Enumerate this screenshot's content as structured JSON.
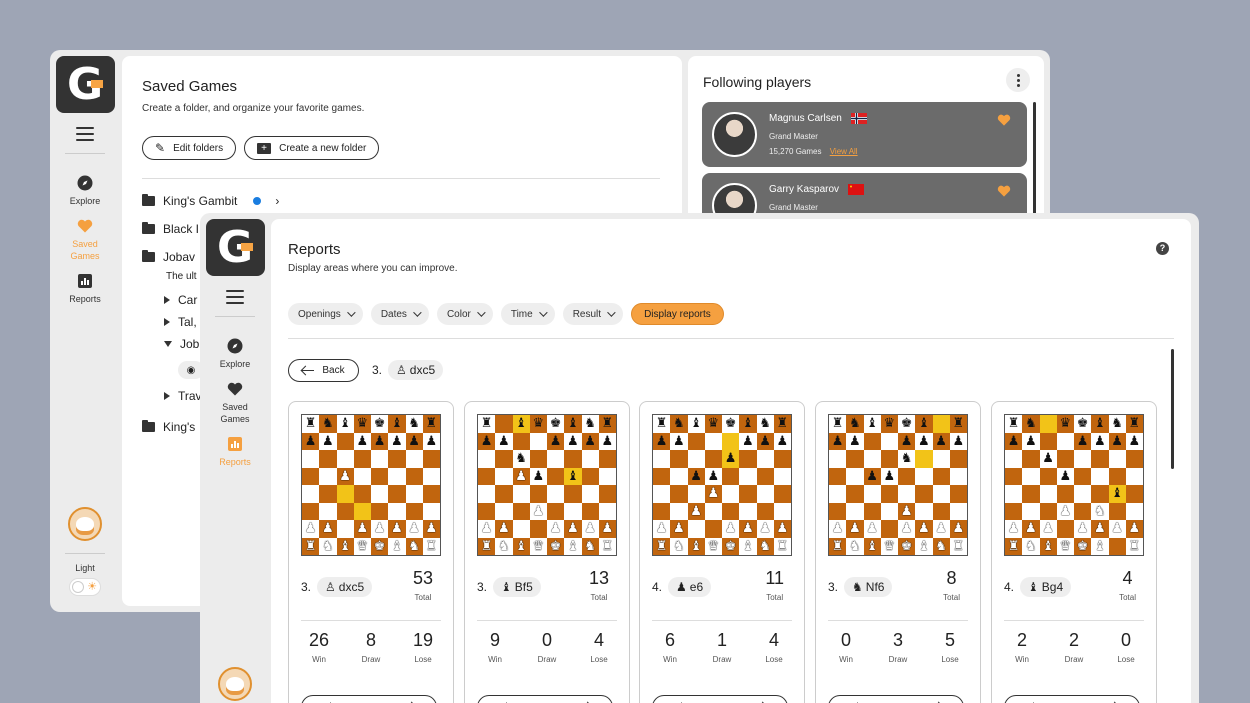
{
  "back": {
    "nav": [
      {
        "label": "Explore",
        "icon": "compass-icon"
      },
      {
        "label": "Saved Games",
        "icon": "heart-icon"
      },
      {
        "label": "Reports",
        "icon": "bar-chart-icon"
      }
    ],
    "theme_label": "Light",
    "saved": {
      "title": "Saved Games",
      "subtitle": "Create a folder, and organize your favorite games.",
      "edit_folders": "Edit folders",
      "create_folder": "Create a new folder",
      "folders": [
        "King's Gambit",
        "Black I",
        "Jobav",
        "King's"
      ],
      "jobav_desc": "The ult",
      "subfolders": [
        "Car",
        "Tal,",
        "Job",
        "Trav"
      ]
    },
    "following": {
      "title": "Following players",
      "players": [
        {
          "name": "Magnus Carlsen",
          "rank": "Grand Master",
          "games": "15,270 Games",
          "view_all": "View All"
        },
        {
          "name": "Garry Kasparov",
          "rank": "Grand Master"
        }
      ]
    }
  },
  "front": {
    "nav": [
      {
        "label": "Explore"
      },
      {
        "label": "Saved Games"
      },
      {
        "label": "Reports"
      }
    ],
    "reports": {
      "title": "Reports",
      "subtitle": "Display areas where you can improve.",
      "help": "?",
      "filters": [
        "Openings",
        "Dates",
        "Color",
        "Time",
        "Result"
      ],
      "display_button": "Display reports",
      "back_button": "Back",
      "current_move": {
        "num": "3.",
        "san": "dxc5"
      },
      "total_label": "Total",
      "win_label": "Win",
      "draw_label": "Draw",
      "lose_label": "Lose",
      "view_games": "View games",
      "cards": [
        {
          "num": "3.",
          "san": "dxc5",
          "total": "53",
          "win": "26",
          "draw": "8",
          "lose": "19"
        },
        {
          "num": "3.",
          "san": "Bf5",
          "total": "13",
          "win": "9",
          "draw": "0",
          "lose": "4"
        },
        {
          "num": "4.",
          "san": "e6",
          "total": "11",
          "win": "6",
          "draw": "1",
          "lose": "4"
        },
        {
          "num": "3.",
          "san": "Nf6",
          "total": "8",
          "win": "0",
          "draw": "3",
          "lose": "5"
        },
        {
          "num": "4.",
          "san": "Bg4",
          "total": "4",
          "win": "2",
          "draw": "2",
          "lose": "0"
        }
      ]
    }
  }
}
